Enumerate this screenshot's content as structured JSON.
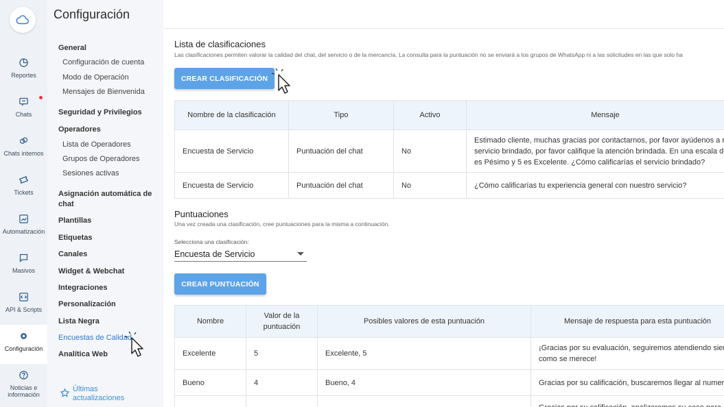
{
  "rail": {
    "items": [
      {
        "label": "Reportes",
        "icon": "pie-chart-icon"
      },
      {
        "label": "Chats",
        "icon": "chat-bubble-icon"
      },
      {
        "label": "Chats internos",
        "icon": "link-chat-icon"
      },
      {
        "label": "Tickets",
        "icon": "ticket-icon"
      },
      {
        "label": "Automatización",
        "icon": "automation-icon"
      },
      {
        "label": "Masivos",
        "icon": "broadcast-icon"
      },
      {
        "label": "API & Scripts",
        "icon": "code-icon"
      },
      {
        "label": "Configuración",
        "icon": "gear-icon"
      },
      {
        "label": "Noticias e información",
        "icon": "question-icon"
      }
    ]
  },
  "sidebar": {
    "title": "Configuración",
    "general": "General",
    "config_cuenta": "Configuración de cuenta",
    "modo_operacion": "Modo de Operación",
    "mensajes_bienvenida": "Mensajes de Bienvenida",
    "seguridad": "Seguridad y Privilegios",
    "operadores": "Operadores",
    "lista_operadores": "Lista de Operadores",
    "grupos_operadores": "Grupos de Operadores",
    "sesiones": "Sesiones activas",
    "asignacion": "Asignación automática de chat",
    "plantillas": "Plantillas",
    "etiquetas": "Etiquetas",
    "canales": "Canales",
    "widget": "Widget & Webchat",
    "integraciones": "Integraciones",
    "personalizacion": "Personalización",
    "lista_negra": "Lista Negra",
    "encuestas": "Encuestas de Calidad",
    "analitica": "Analítica Web",
    "updates_line1": "Últimas",
    "updates_line2": "actualizaciones"
  },
  "clasificaciones": {
    "title": "Lista de clasificaciones",
    "description": "Las clasificaciones permiten valorar la calidad del chat, del servicio o de la mercancía. La consulta para la puntuación no se enviará a los grupos de WhatsApp ni a las solicitudes en las que solo ha",
    "button": "CREAR CLASIFICACIÓN",
    "headers": [
      "Nombre de la clasificación",
      "Tipo",
      "Activo",
      "Mensaje"
    ],
    "rows": [
      {
        "nombre": "Encuesta de Servicio",
        "tipo": "Puntuación del chat",
        "activo": "No",
        "mensaje": "Estimado cliente, muchas gracias por contactarnos, por favor ayúdenos a me servicio brindado, por favor califique la atención brindada. En una escala de 1 es Pésimo y 5 es Excelente. ¿Cómo calificarías el servicio brindado?"
      },
      {
        "nombre": "Encuesta de Servicio",
        "tipo": "Puntuación del chat",
        "activo": "No",
        "mensaje": "¿Cómo calificarías tu experiencia general con nuestro servicio?"
      }
    ]
  },
  "puntuaciones": {
    "title": "Puntuaciones",
    "description": "Una vez creada una clasificación, cree puntuaciones para la misma a continuación.",
    "select_label": "Selecciona una clasificación:",
    "select_value": "Encuesta de Servicio",
    "button": "CREAR PUNTUACIÓN",
    "headers": [
      "Nombre",
      "Valor de la puntuación",
      "Posibles valores de esta puntuación",
      "Mensaje de respuesta para esta puntuación"
    ],
    "rows": [
      {
        "nombre": "Excelente",
        "valor": "5",
        "posibles": "Excelente, 5",
        "mensaje": "¡Gracias por su evaluación, seguiremos atendiendo siemp como se merece!"
      },
      {
        "nombre": "Bueno",
        "valor": "4",
        "posibles": "Bueno, 4",
        "mensaje": "Gracias por su calificación, buscaremos llegar al numero"
      },
      {
        "nombre": "",
        "valor": "",
        "posibles": "",
        "mensaje": "Gracias por su calificación, analizaremos su caso para"
      }
    ]
  },
  "colors": {
    "accent": "#5da3e8",
    "link": "#2a7ad1",
    "rail_bg": "#eef1f6",
    "sidebar_bg": "#f4f6f9"
  }
}
